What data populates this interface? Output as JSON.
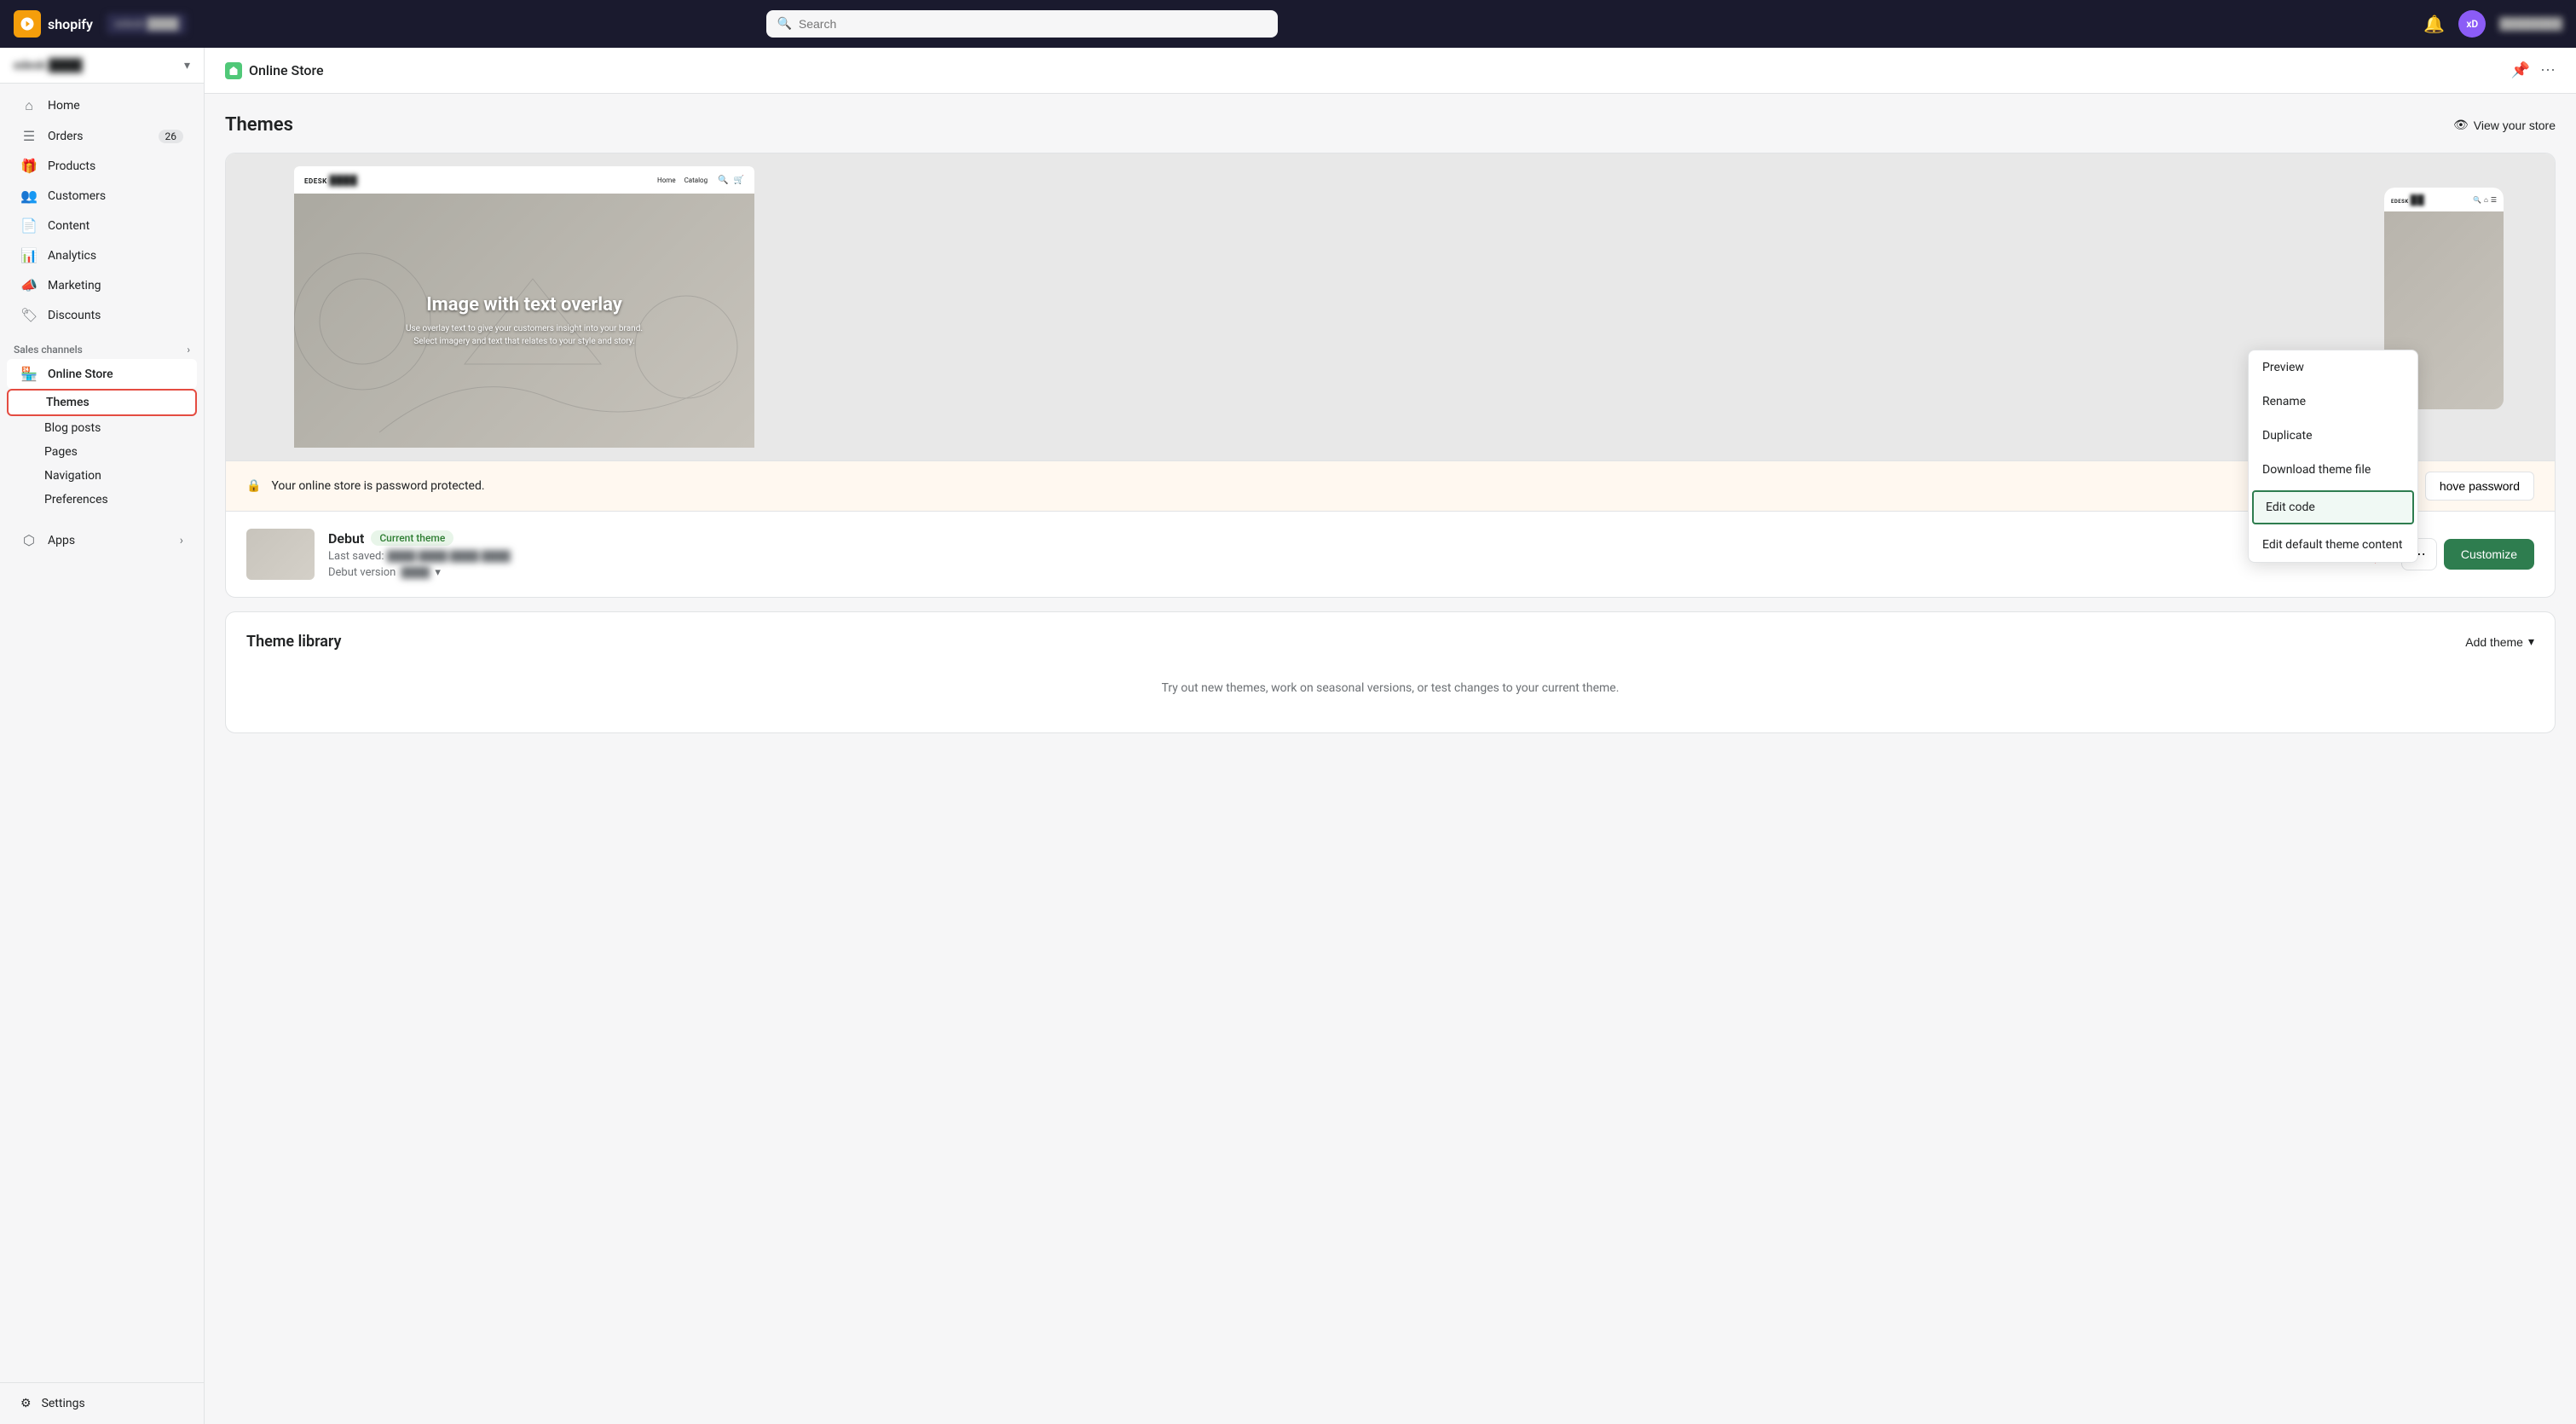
{
  "topbar": {
    "logo_text": "shopify",
    "store_label": "edesk ████",
    "search_placeholder": "Search",
    "notification_icon": "🔔",
    "avatar_initials": "xD",
    "user_name": "████████"
  },
  "sidebar": {
    "store_selector": {
      "name": "edesk ████",
      "arrow": "▾"
    },
    "nav_items": [
      {
        "id": "home",
        "label": "Home",
        "icon": "⌂",
        "badge": null
      },
      {
        "id": "orders",
        "label": "Orders",
        "icon": "☰",
        "badge": "26"
      },
      {
        "id": "products",
        "label": "Products",
        "icon": "🎁",
        "badge": null
      },
      {
        "id": "customers",
        "label": "Customers",
        "icon": "👥",
        "badge": null
      },
      {
        "id": "content",
        "label": "Content",
        "icon": "📄",
        "badge": null
      },
      {
        "id": "analytics",
        "label": "Analytics",
        "icon": "📊",
        "badge": null
      },
      {
        "id": "marketing",
        "label": "Marketing",
        "icon": "📣",
        "badge": null
      },
      {
        "id": "discounts",
        "label": "Discounts",
        "icon": "🏷",
        "badge": null
      }
    ],
    "sales_channels_label": "Sales channels",
    "sales_channels_arrow": "›",
    "online_store": {
      "label": "Online Store",
      "icon": "🏪",
      "sub_items": [
        {
          "id": "themes",
          "label": "Themes",
          "active": true
        },
        {
          "id": "blog_posts",
          "label": "Blog posts"
        },
        {
          "id": "pages",
          "label": "Pages"
        },
        {
          "id": "navigation",
          "label": "Navigation"
        },
        {
          "id": "preferences",
          "label": "Preferences"
        }
      ]
    },
    "apps": {
      "label": "Apps",
      "arrow": "›"
    },
    "settings": {
      "label": "Settings",
      "icon": "⚙"
    }
  },
  "page_header": {
    "icon": "🏪",
    "title": "Online Store",
    "pin_icon": "📌",
    "more_icon": "⋯"
  },
  "themes_section": {
    "title": "Themes",
    "view_store_label": "View your store",
    "view_store_icon": "👁"
  },
  "theme_preview": {
    "hero_title": "Image with text overlay",
    "hero_description": "Use overlay text to give your customers insight into your brand. Select imagery and text that relates to your style and story.",
    "desktop_nav_logo": "EDESK ████",
    "desktop_nav_links": [
      "Home",
      "Catalog"
    ],
    "mobile_logo": "EDESK ████"
  },
  "password_banner": {
    "icon": "🔒",
    "text": "Your online store is password protected.",
    "remove_btn": "hove password"
  },
  "current_theme": {
    "name": "Debut",
    "badge": "Current theme",
    "last_saved_label": "Last saved:",
    "last_saved_value": "████ ████ ████ ████",
    "version_label": "Debut version",
    "version_value": "████",
    "version_arrow": "▾"
  },
  "theme_actions": {
    "dots_btn": "⋯",
    "customize_btn": "Customize"
  },
  "dropdown_menu": {
    "items": [
      {
        "id": "preview",
        "label": "Preview"
      },
      {
        "id": "rename",
        "label": "Rename"
      },
      {
        "id": "duplicate",
        "label": "Duplicate"
      },
      {
        "id": "download",
        "label": "Download theme file"
      },
      {
        "id": "edit_code",
        "label": "Edit code",
        "active": true
      },
      {
        "id": "edit_default",
        "label": "Edit default theme content"
      }
    ]
  },
  "theme_library": {
    "title": "Theme library",
    "add_theme_label": "Add theme",
    "add_theme_arrow": "▾",
    "description": "Try out new themes, work on seasonal versions, or test changes to your current theme."
  },
  "colors": {
    "accent_green": "#2e7d4f",
    "current_badge_bg": "#e8f5e9",
    "current_badge_text": "#2e7d32",
    "red_arrow": "#e44c41",
    "highlight_border": "#e44c41"
  }
}
